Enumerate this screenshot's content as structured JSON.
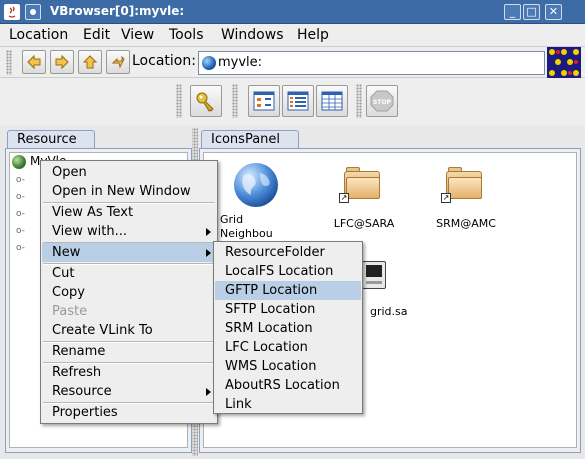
{
  "window": {
    "title": "VBrowser[0]:myvle:"
  },
  "menubar": [
    "Location",
    "Edit",
    "View",
    "Tools",
    "Windows",
    "Help"
  ],
  "toolbar": {
    "location_label": "Location:",
    "location_value": "myvle:"
  },
  "left_panel": {
    "tab": "Resource",
    "tree_root": "MyVle"
  },
  "right_panel": {
    "tab": "IconsPanel",
    "icons": [
      {
        "label": "Grid Neighbou rhood",
        "icon": "globe-icon"
      },
      {
        "label": "LFC@SARA",
        "icon": "folder-link-icon"
      },
      {
        "label": "SRM@AMC",
        "icon": "folder-link-icon"
      },
      {
        "label": "grid.sa",
        "icon": "computer-icon"
      }
    ]
  },
  "context_menu": {
    "items": [
      {
        "label": "Open"
      },
      {
        "label": "Open in New Window"
      },
      {
        "label": "View As Text"
      },
      {
        "label": "View with..."
      },
      {
        "label": "New"
      },
      {
        "label": "Cut"
      },
      {
        "label": "Copy"
      },
      {
        "label": "Paste",
        "disabled": true
      },
      {
        "label": "Create VLink To"
      },
      {
        "label": "Rename"
      },
      {
        "label": "Refresh"
      },
      {
        "label": "Resource"
      },
      {
        "label": "Properties"
      }
    ]
  },
  "submenu_new": {
    "items": [
      "ResourceFolder",
      "LocalFS Location",
      "GFTP Location",
      "SFTP Location",
      "SRM Location",
      "LFC Location",
      "WMS Location",
      "AboutRS Location",
      "Link"
    ],
    "selected": "GFTP Location"
  },
  "colors": {
    "titlebar": "#3d6ba5",
    "selection": "#b8cfe5",
    "panel_border": "#8aa0c8"
  }
}
